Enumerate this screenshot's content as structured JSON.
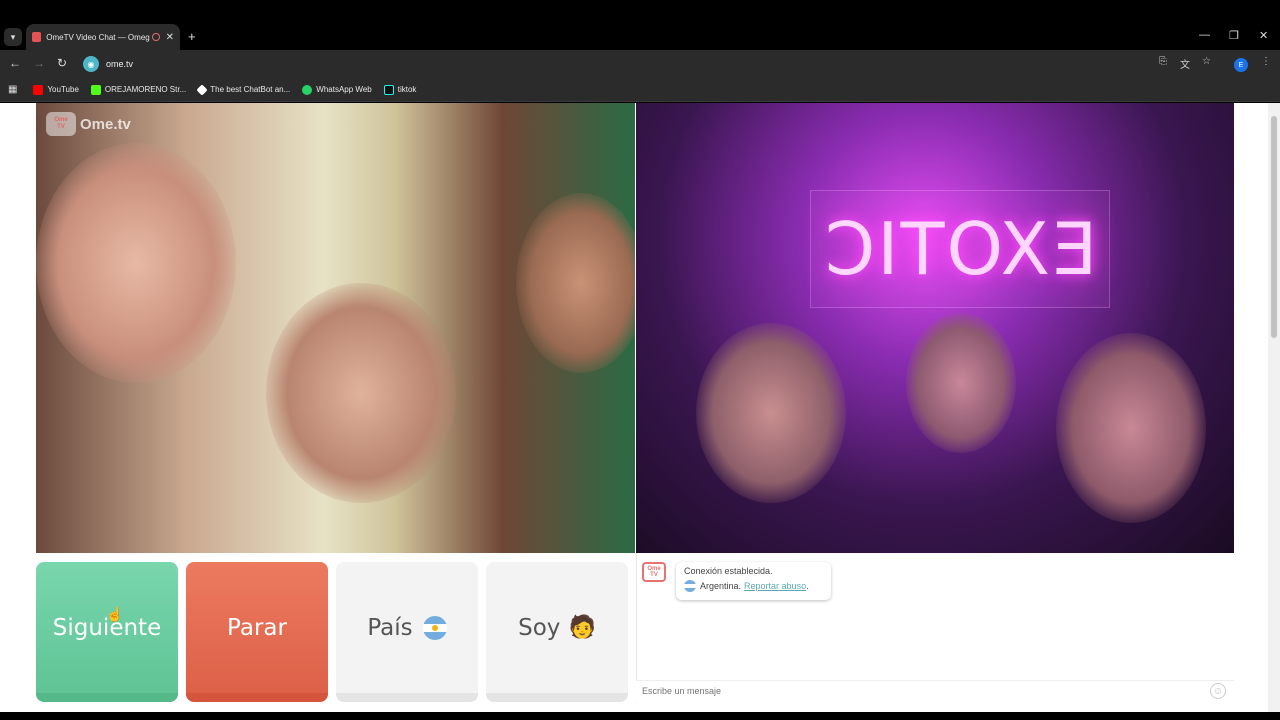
{
  "browser": {
    "tab": {
      "title": "OmeTV Video Chat — Omegle"
    },
    "address": {
      "url": "ome.tv"
    },
    "profile_initial": "E",
    "bookmarks": [
      {
        "label": "YouTube",
        "color": "#ff0000"
      },
      {
        "label": "OREJAMORENO Str...",
        "color": "#53fc18"
      },
      {
        "label": "The best ChatBot an...",
        "color": "#ffffff"
      },
      {
        "label": "WhatsApp Web",
        "color": "#25d366"
      },
      {
        "label": "tiktok",
        "color": "#000000"
      }
    ]
  },
  "app": {
    "logo_text": "Ome.tv",
    "logo_badge_line1": "Ome",
    "logo_badge_line2": "TV",
    "neon_sign": "EXOTIC"
  },
  "controls": {
    "next_label": "Siguiente",
    "stop_label": "Parar",
    "country_label": "País",
    "gender_label": "Soy"
  },
  "chat": {
    "status": "Conexión establecida.",
    "country": "Argentina.",
    "report_link": "Reportar abuso",
    "report_suffix": ".",
    "input_placeholder": "Escribe un mensaje"
  }
}
